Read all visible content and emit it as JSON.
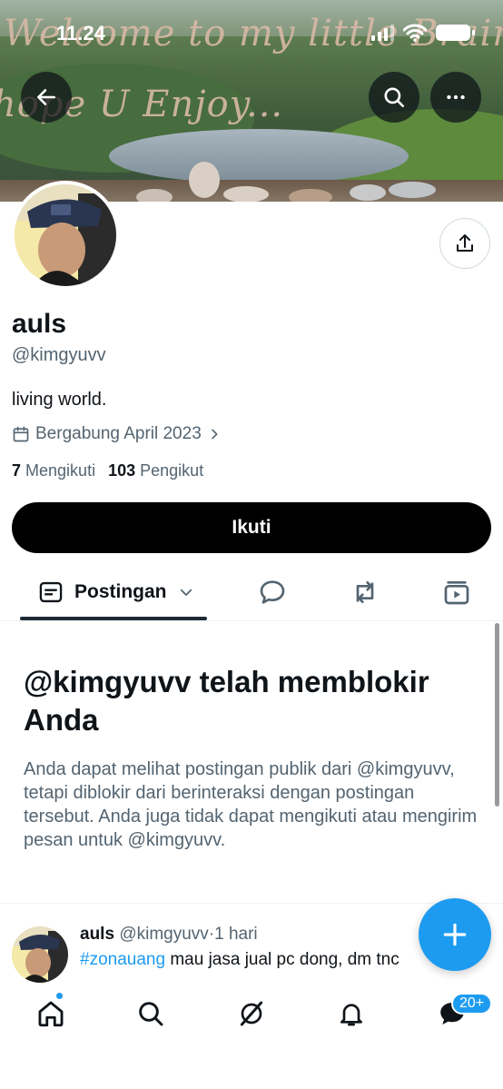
{
  "status_bar": {
    "time": "11.24"
  },
  "banner": {
    "caption_line1": "Welcome to my little Brain...",
    "caption_line2": "hope U Enjoy..."
  },
  "profile": {
    "name": "auls",
    "handle": "@kimgyuvv",
    "bio": "living world.",
    "joined": "Bergabung April 2023",
    "following_count": "7",
    "following_label": "Mengikuti",
    "followers_count": "103",
    "followers_label": "Pengikut",
    "follow_button": "Ikuti"
  },
  "tabs": {
    "posts_label": "Postingan"
  },
  "blocked": {
    "title": "@kimgyuvv telah memblokir Anda",
    "body": "Anda dapat melihat postingan publik dari @kimgyuvv, tetapi diblokir dari berinteraksi dengan postingan tersebut. Anda juga tidak dapat mengikuti atau mengirim pesan untuk @kimgyuvv."
  },
  "post": {
    "name": "auls",
    "handle": "@kimgyuvv",
    "separator": "·",
    "time": "1 hari",
    "hashtag": "#zonauang",
    "text": " mau jasa jual pc dong, dm tnc"
  },
  "bottom_nav": {
    "messages_badge": "20+"
  },
  "colors": {
    "accent": "#1d9bf0",
    "text": "#0f1419",
    "muted": "#536471"
  }
}
